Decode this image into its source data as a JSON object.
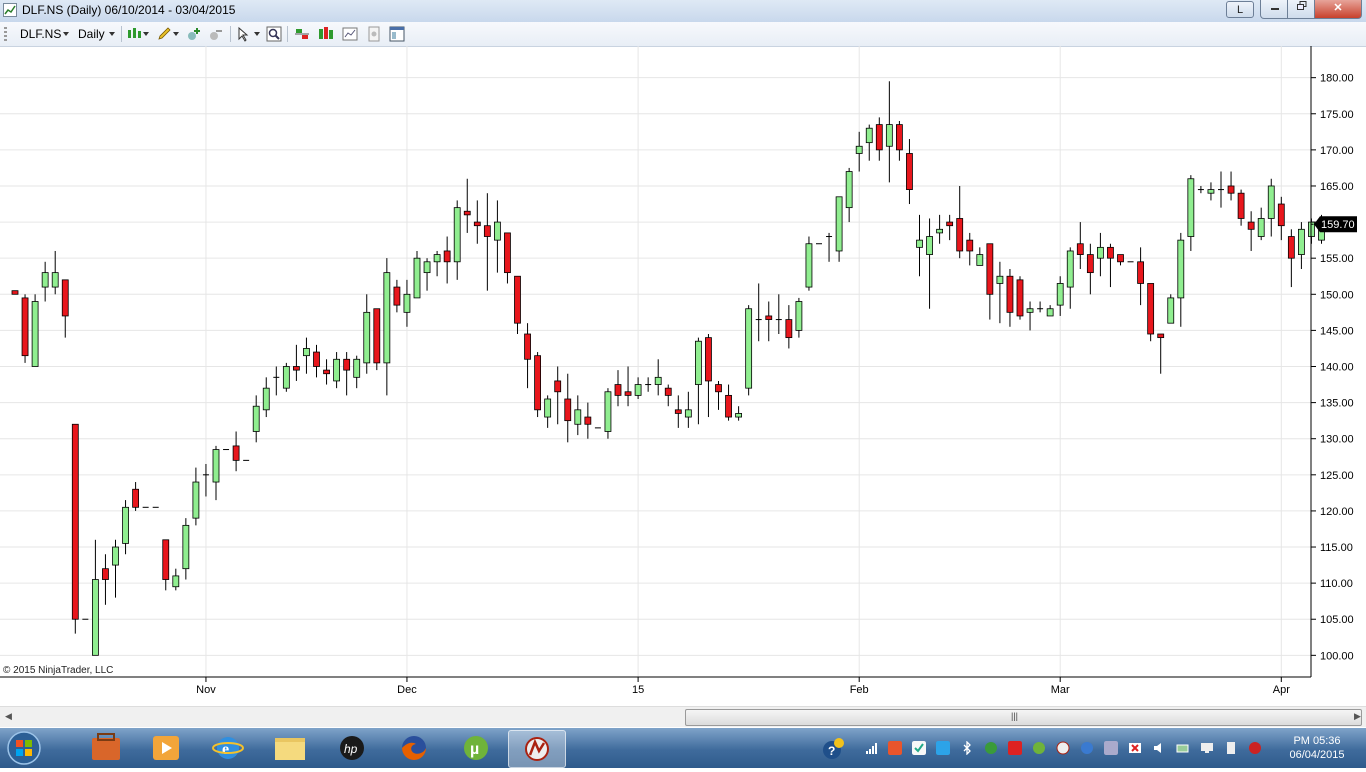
{
  "window": {
    "title": "DLF.NS (Daily)  06/10/2014 - 03/04/2015",
    "layout_button": "L",
    "close_label": "✕"
  },
  "toolbar": {
    "instrument": "DLF.NS",
    "interval": "Daily"
  },
  "chart_data": {
    "type": "candlestick",
    "title": "",
    "ylim": [
      97,
      183
    ],
    "yticks": [
      100,
      105,
      110,
      115,
      120,
      125,
      130,
      135,
      140,
      145,
      150,
      155,
      160,
      165,
      170,
      175,
      180
    ],
    "ytick_labels": [
      "100.00",
      "105.00",
      "110.00",
      "115.00",
      "120.00",
      "125.00",
      "130.00",
      "135.00",
      "140.00",
      "145.00",
      "150.00",
      "155.00",
      "160.00",
      "165.00",
      "170.00",
      "175.00",
      "180.00"
    ],
    "xticks": [
      {
        "label": "Nov",
        "index": 19
      },
      {
        "label": "Dec",
        "index": 39
      },
      {
        "label": "15",
        "index": 62
      },
      {
        "label": "Feb",
        "index": 84
      },
      {
        "label": "Mar",
        "index": 104
      },
      {
        "label": "Apr",
        "index": 126
      }
    ],
    "last_price_label": "159.70",
    "up_color": "#90ee90",
    "down_color": "#e8161c",
    "candles": [
      [
        150.5,
        150.5,
        150.0,
        150.0
      ],
      [
        149.5,
        150.0,
        140.5,
        141.5
      ],
      [
        140.0,
        150.0,
        140.0,
        149.0
      ],
      [
        151.0,
        154.5,
        149.0,
        153.0
      ],
      [
        151.0,
        156.0,
        150.0,
        153.0
      ],
      [
        152.0,
        152.0,
        144.0,
        147.0
      ],
      [
        132.0,
        132.0,
        103.0,
        105.0
      ],
      [
        105.0,
        105.0,
        105.0,
        105.0
      ],
      [
        100.0,
        116.0,
        100.0,
        110.5
      ],
      [
        112.0,
        114.0,
        107.0,
        110.5
      ],
      [
        112.5,
        116.0,
        108.0,
        115.0
      ],
      [
        115.5,
        121.5,
        114.0,
        120.5
      ],
      [
        123.0,
        124.0,
        120.0,
        120.5
      ],
      [
        120.5,
        120.5,
        120.5,
        120.5
      ],
      [
        120.5,
        120.5,
        120.5,
        120.5
      ],
      [
        116.0,
        116.0,
        109.0,
        110.5
      ],
      [
        109.5,
        112.0,
        109.0,
        111.0
      ],
      [
        112.0,
        119.0,
        110.5,
        118.0
      ],
      [
        119.0,
        126.0,
        118.0,
        124.0
      ],
      [
        125.0,
        126.5,
        122.0,
        125.0
      ],
      [
        124.0,
        129.0,
        121.5,
        128.5
      ],
      [
        128.5,
        128.5,
        128.5,
        128.5
      ],
      [
        129.0,
        131.0,
        125.5,
        127.0
      ],
      [
        127.0,
        127.0,
        127.0,
        127.0
      ],
      [
        131.0,
        136.0,
        129.5,
        134.5
      ],
      [
        134.0,
        138.5,
        133.0,
        137.0
      ],
      [
        138.5,
        140.0,
        136.0,
        138.5
      ],
      [
        137.0,
        140.5,
        136.5,
        140.0
      ],
      [
        140.0,
        143.0,
        138.0,
        139.5
      ],
      [
        141.5,
        144.0,
        139.0,
        142.5
      ],
      [
        142.0,
        143.0,
        138.5,
        140.0
      ],
      [
        139.5,
        141.0,
        137.5,
        139.0
      ],
      [
        138.0,
        142.0,
        137.0,
        141.0
      ],
      [
        141.0,
        142.0,
        136.0,
        139.5
      ],
      [
        138.5,
        141.5,
        137.0,
        141.0
      ],
      [
        140.5,
        150.0,
        139.0,
        147.5
      ],
      [
        148.0,
        148.0,
        139.5,
        140.5
      ],
      [
        140.5,
        155.0,
        136.0,
        153.0
      ],
      [
        151.0,
        152.0,
        147.5,
        148.5
      ],
      [
        147.5,
        152.0,
        145.5,
        150.0
      ],
      [
        149.5,
        156.0,
        149.5,
        155.0
      ],
      [
        153.0,
        155.0,
        150.5,
        154.5
      ],
      [
        154.5,
        156.0,
        152.5,
        155.5
      ],
      [
        156.0,
        158.0,
        151.5,
        154.5
      ],
      [
        154.5,
        163.0,
        152.0,
        162.0
      ],
      [
        161.5,
        166.0,
        158.5,
        161.0
      ],
      [
        160.0,
        163.0,
        157.0,
        159.5
      ],
      [
        159.5,
        164.0,
        150.5,
        158.0
      ],
      [
        157.5,
        163.0,
        153.0,
        160.0
      ],
      [
        158.5,
        158.5,
        151.5,
        153.0
      ],
      [
        152.5,
        152.5,
        144.5,
        146.0
      ],
      [
        144.5,
        146.0,
        137.0,
        141.0
      ],
      [
        141.5,
        142.0,
        133.0,
        134.0
      ],
      [
        133.0,
        136.0,
        131.5,
        135.5
      ],
      [
        138.0,
        140.0,
        132.0,
        136.5
      ],
      [
        135.5,
        139.0,
        129.5,
        132.5
      ],
      [
        132.0,
        136.0,
        130.5,
        134.0
      ],
      [
        133.0,
        135.0,
        130.0,
        132.0
      ],
      [
        131.5,
        131.5,
        131.5,
        131.5
      ],
      [
        131.0,
        137.0,
        130.0,
        136.5
      ],
      [
        137.5,
        139.5,
        134.5,
        136.0
      ],
      [
        136.5,
        140.0,
        134.5,
        136.0
      ],
      [
        136.0,
        138.5,
        135.5,
        137.5
      ],
      [
        137.5,
        138.5,
        136.5,
        137.5
      ],
      [
        137.5,
        141.0,
        136.0,
        138.5
      ],
      [
        137.0,
        137.5,
        134.5,
        136.0
      ],
      [
        134.0,
        136.0,
        131.5,
        133.5
      ],
      [
        133.0,
        136.5,
        131.5,
        134.0
      ],
      [
        137.5,
        144.0,
        132.0,
        143.5
      ],
      [
        144.0,
        144.5,
        133.0,
        138.0
      ],
      [
        137.5,
        138.0,
        134.0,
        136.5
      ],
      [
        136.0,
        137.5,
        132.5,
        133.0
      ],
      [
        133.0,
        134.5,
        132.5,
        133.5
      ],
      [
        137.0,
        148.5,
        136.0,
        148.0
      ],
      [
        146.5,
        151.5,
        143.5,
        146.5
      ],
      [
        147.0,
        149.0,
        143.5,
        146.5
      ],
      [
        146.5,
        150.0,
        144.5,
        146.5
      ],
      [
        146.5,
        148.5,
        142.5,
        144.0
      ],
      [
        145.0,
        149.5,
        144.0,
        149.0
      ],
      [
        151.0,
        158.0,
        150.5,
        157.0
      ],
      [
        157.0,
        157.0,
        157.0,
        157.0
      ],
      [
        158.0,
        158.5,
        154.5,
        158.0
      ],
      [
        156.0,
        163.5,
        154.5,
        163.5
      ],
      [
        162.0,
        167.5,
        160.0,
        167.0
      ],
      [
        169.5,
        172.5,
        167.0,
        170.5
      ],
      [
        171.0,
        173.5,
        168.5,
        173.0
      ],
      [
        173.5,
        174.5,
        168.5,
        170.0
      ],
      [
        170.5,
        179.5,
        165.5,
        173.5
      ],
      [
        173.5,
        174.0,
        168.5,
        170.0
      ],
      [
        169.5,
        171.5,
        162.5,
        164.5
      ],
      [
        156.5,
        161.0,
        152.5,
        157.5
      ],
      [
        155.5,
        160.5,
        148.0,
        158.0
      ],
      [
        158.5,
        161.0,
        157.0,
        159.0
      ],
      [
        160.0,
        161.0,
        157.5,
        159.5
      ],
      [
        160.5,
        165.0,
        155.0,
        156.0
      ],
      [
        157.5,
        158.5,
        154.0,
        156.0
      ],
      [
        154.0,
        156.5,
        154.0,
        155.5
      ],
      [
        157.0,
        157.0,
        146.5,
        150.0
      ],
      [
        151.5,
        154.5,
        146.0,
        152.5
      ],
      [
        152.5,
        153.5,
        145.5,
        147.5
      ],
      [
        152.0,
        152.5,
        146.5,
        147.0
      ],
      [
        147.5,
        149.0,
        145.0,
        148.0
      ],
      [
        148.0,
        149.0,
        147.5,
        148.0
      ],
      [
        147.0,
        148.5,
        147.0,
        148.0
      ],
      [
        148.5,
        152.5,
        147.0,
        151.5
      ],
      [
        151.0,
        156.5,
        148.0,
        156.0
      ],
      [
        157.0,
        160.0,
        153.5,
        155.5
      ],
      [
        155.5,
        157.0,
        150.0,
        153.0
      ],
      [
        155.0,
        158.5,
        152.5,
        156.5
      ],
      [
        156.5,
        157.0,
        151.0,
        155.0
      ],
      [
        155.5,
        155.5,
        154.0,
        154.5
      ],
      [
        154.5,
        154.5,
        154.5,
        154.5
      ],
      [
        154.5,
        156.5,
        148.5,
        151.5
      ],
      [
        151.5,
        151.5,
        143.5,
        144.5
      ],
      [
        144.5,
        144.5,
        139.0,
        144.0
      ],
      [
        146.0,
        150.0,
        146.0,
        149.5
      ],
      [
        149.5,
        158.5,
        145.5,
        157.5
      ],
      [
        158.0,
        166.5,
        156.0,
        166.0
      ],
      [
        164.5,
        165.0,
        164.0,
        164.5
      ],
      [
        164.0,
        165.5,
        163.0,
        164.5
      ],
      [
        164.5,
        167.0,
        162.0,
        164.5
      ],
      [
        165.0,
        167.0,
        163.0,
        164.0
      ],
      [
        164.0,
        164.5,
        159.5,
        160.5
      ],
      [
        160.0,
        161.5,
        156.0,
        159.0
      ],
      [
        158.0,
        162.0,
        157.5,
        160.5
      ],
      [
        160.5,
        166.0,
        158.0,
        165.0
      ],
      [
        162.5,
        163.5,
        157.5,
        159.5
      ],
      [
        158.0,
        159.0,
        151.0,
        155.0
      ],
      [
        155.5,
        160.0,
        153.5,
        159.0
      ],
      [
        158.0,
        160.5,
        157.0,
        160.0
      ],
      [
        157.5,
        161.0,
        157.0,
        159.7
      ],
      [
        159.7,
        159.7,
        159.7,
        159.7
      ]
    ]
  },
  "footer": {
    "copyright": "© 2015 NinjaTrader, LLC"
  },
  "taskbar": {
    "clock_time": "PM 05:36",
    "clock_date": "06/04/2015"
  }
}
